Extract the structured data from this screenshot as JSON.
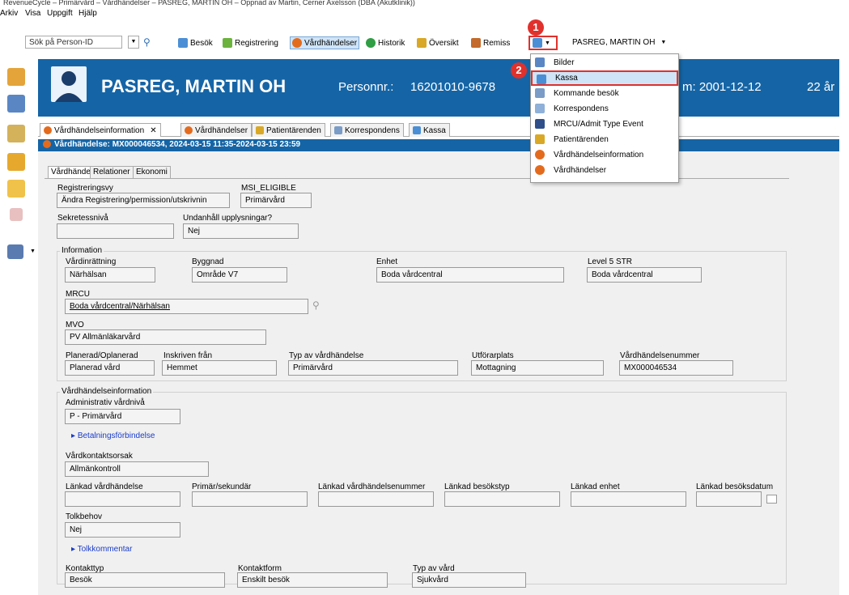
{
  "window": {
    "title": "RevenueCycle – Primärvård – Vårdhändelser – PASREG, MARTIN OH – Öppnad av Martin, Cerner Axelsson (DBA (Akutklinik))"
  },
  "menu": [
    "Arkiv",
    "Visa",
    "Uppgift",
    "Hjälp"
  ],
  "toolbar": {
    "search_placeholder": "Sök på Person-ID",
    "buttons": [
      "Besök",
      "Registrering",
      "Vårdhändelser",
      "Historik",
      "Översikt",
      "Remiss"
    ],
    "user": "PASREG, MARTIN OH"
  },
  "banner": {
    "name": "PASREG, MARTIN OH",
    "personnr_label": "Personnr.:",
    "personnr": "16201010-9678",
    "date_partial": "m: 2001-12-12",
    "age": "22 år"
  },
  "tabs": [
    "Vårdhändelseinformation",
    "Vårdhändelser",
    "Patientärenden",
    "Korrespondens",
    "Kassa"
  ],
  "event_header": "Vårdhändelse: MX000046534, 2024-03-15 11:35-2024-03-15 23:59",
  "subtabs": [
    "Vårdhändelse",
    "Relationer",
    "Ekonomi"
  ],
  "form": {
    "registreringsvy_label": "Registreringsvy",
    "registreringsvy": "Ändra Registrering/permission/utskrivnin",
    "msi_label": "MSI_ELIGIBLE",
    "msi": "Primärvård",
    "sekretess_label": "Sekretessnivå",
    "sekretess": "",
    "undanhall_label": "Undanhåll upplysningar?",
    "undanhall": "Nej",
    "info_group": "Information",
    "vardinrattning_label": "Vårdinrättning",
    "vardinrattning": "Närhälsan",
    "byggnad_label": "Byggnad",
    "byggnad": "Område V7",
    "enhet_label": "Enhet",
    "enhet": "Boda vårdcentral",
    "level5_label": "Level 5 STR",
    "level5": "Boda vårdcentral",
    "mrcu_label": "MRCU",
    "mrcu": "Boda vårdcentral/Närhälsan",
    "mvo_label": "MVO",
    "mvo": "PV Allmänläkarvård",
    "planerad_label": "Planerad/Oplanerad",
    "planerad": "Planerad vård",
    "inskriven_label": "Inskriven från",
    "inskriven": "Hemmet",
    "typ_label": "Typ av vårdhändelse",
    "typ": "Primärvård",
    "utforar_label": "Utförarplats",
    "utforar": "Mottagning",
    "nummer_label": "Vårdhändelsenummer",
    "nummer": "MX000046534",
    "vh_group": "Vårdhändelseinformation",
    "admin_label": "Administrativ vårdnivå",
    "admin": "P - Primärvård",
    "betalning_link": "Betalningsförbindelse",
    "kontaktorsak_label": "Vårdkontaktsorsak",
    "kontaktorsak": "Allmänkontroll",
    "lankad_vh_label": "Länkad vårdhändelse",
    "primar_label": "Primär/sekundär",
    "lankad_nr_label": "Länkad vårdhändelsenummer",
    "lankad_typ_label": "Länkad besökstyp",
    "lankad_enhet_label": "Länkad enhet",
    "lankad_datum_label": "Länkad besöksdatum",
    "tolk_label": "Tolkbehov",
    "tolk": "Nej",
    "tolkkommentar_link": "Tolkkommentar",
    "kontakttyp_label": "Kontakttyp",
    "kontakttyp": "Besök",
    "kontaktform_label": "Kontaktform",
    "kontaktform": "Enskilt besök",
    "typvard_label": "Typ av vård",
    "typvard": "Sjukvård"
  },
  "dropdown": [
    "Bilder",
    "Kassa",
    "Kommande besök",
    "Korrespondens",
    "MRCU/Admit Type Event",
    "Patientärenden",
    "Vårdhändelseinformation",
    "Vårdhändelser"
  ],
  "badges": [
    "1",
    "2"
  ],
  "colors": {
    "banner": "#1565a6",
    "highlight": "#e0312d",
    "selected": "#cfe4f7"
  }
}
